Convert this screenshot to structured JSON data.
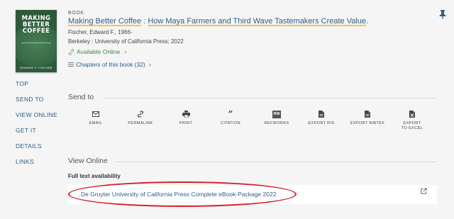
{
  "cover": {
    "title": "MAKING\nBETTER\nCOFFEE",
    "author": "EDWARD F. FISCHER"
  },
  "record": {
    "type": "BOOK",
    "title_main": "Making Better Coffee",
    "title_sep": " : ",
    "title_sub": "How Maya Farmers and Third Wave Tastemakers Create Value",
    "title_end": ".",
    "author": "Fischer, Edward F., 1966-",
    "publisher": "Berkeley : University of California Press; 2022",
    "availability": "Available Online",
    "chapters": "Chapters of this book (32)"
  },
  "sidenav": [
    "TOP",
    "SEND TO",
    "VIEW ONLINE",
    "GET IT",
    "DETAILS",
    "LINKS"
  ],
  "send_to": {
    "heading": "Send to",
    "actions": [
      {
        "icon": "email-icon",
        "label": "EMAIL"
      },
      {
        "icon": "permalink-icon",
        "label": "PERMALINK"
      },
      {
        "icon": "print-icon",
        "label": "PRINT"
      },
      {
        "icon": "citation-icon",
        "label": "CITATION"
      },
      {
        "icon": "refworks-icon",
        "label": "REFWORKS"
      },
      {
        "icon": "export-ris-icon",
        "label": "EXPORT RIS"
      },
      {
        "icon": "export-bibtex-icon",
        "label": "EXPORT BIBTEX"
      },
      {
        "icon": "export-excel-icon",
        "label": "EXPORT TO EXCEL"
      }
    ]
  },
  "view_online": {
    "heading": "View Online",
    "full_text_label": "Full text availability",
    "link": "De Gruyter University of California Press Complete eBook-Package 2022"
  },
  "colors": {
    "link": "#2b5d8b",
    "available": "#3d8a3d",
    "highlight": "#f2c744",
    "annotation": "#d81f26"
  }
}
